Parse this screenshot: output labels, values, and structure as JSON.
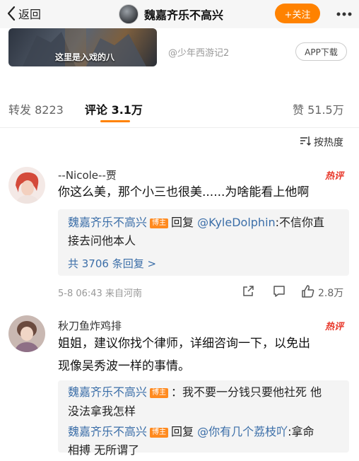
{
  "header": {
    "back_label": "返回",
    "title": "魏嘉齐乐不高兴",
    "follow_label": "+关注"
  },
  "banner": {
    "caption": "这里是入戏的八",
    "source": "@少年西游记2",
    "app_button": "APP下载"
  },
  "tabs": {
    "repost": "转发 8223",
    "comment": "评论 3.1万",
    "like": "赞 51.5万"
  },
  "sort_label": "按热度",
  "comments": [
    {
      "name": "--Nicole--贾",
      "hot": "热评",
      "text": "你这么美，那个小三也很美......为啥能看上他啊",
      "replies": [
        {
          "author": "魏嘉齐乐不高兴",
          "badge": "博主",
          "prefix": "回复",
          "mention": "@KyleDolphin",
          "text_line1": ":不信你直",
          "text_line2": "接去问他本人"
        }
      ],
      "more_replies": "共 3706 条回复 >",
      "meta": "5-8 06:43  来自河南",
      "likes": "2.8万"
    },
    {
      "name": "秋刀鱼炸鸡排",
      "hot": "热评",
      "text_line1": "姐姐，建议你找个律师，详细咨询一下，以免出",
      "text_line2": "现像吴秀波一样的事情。",
      "replies": [
        {
          "author": "魏嘉齐乐不高兴",
          "badge": "博主",
          "text_line1": "：我不要一分钱只要他社死 他",
          "text_line2": "没法拿我怎样"
        },
        {
          "author": "魏嘉齐乐不高兴",
          "badge": "博主",
          "prefix": "回复",
          "mention": "@你有几个荔枝吖",
          "text_line1": ":拿命",
          "text_line2": "相搏 无所谓了"
        }
      ]
    }
  ]
}
